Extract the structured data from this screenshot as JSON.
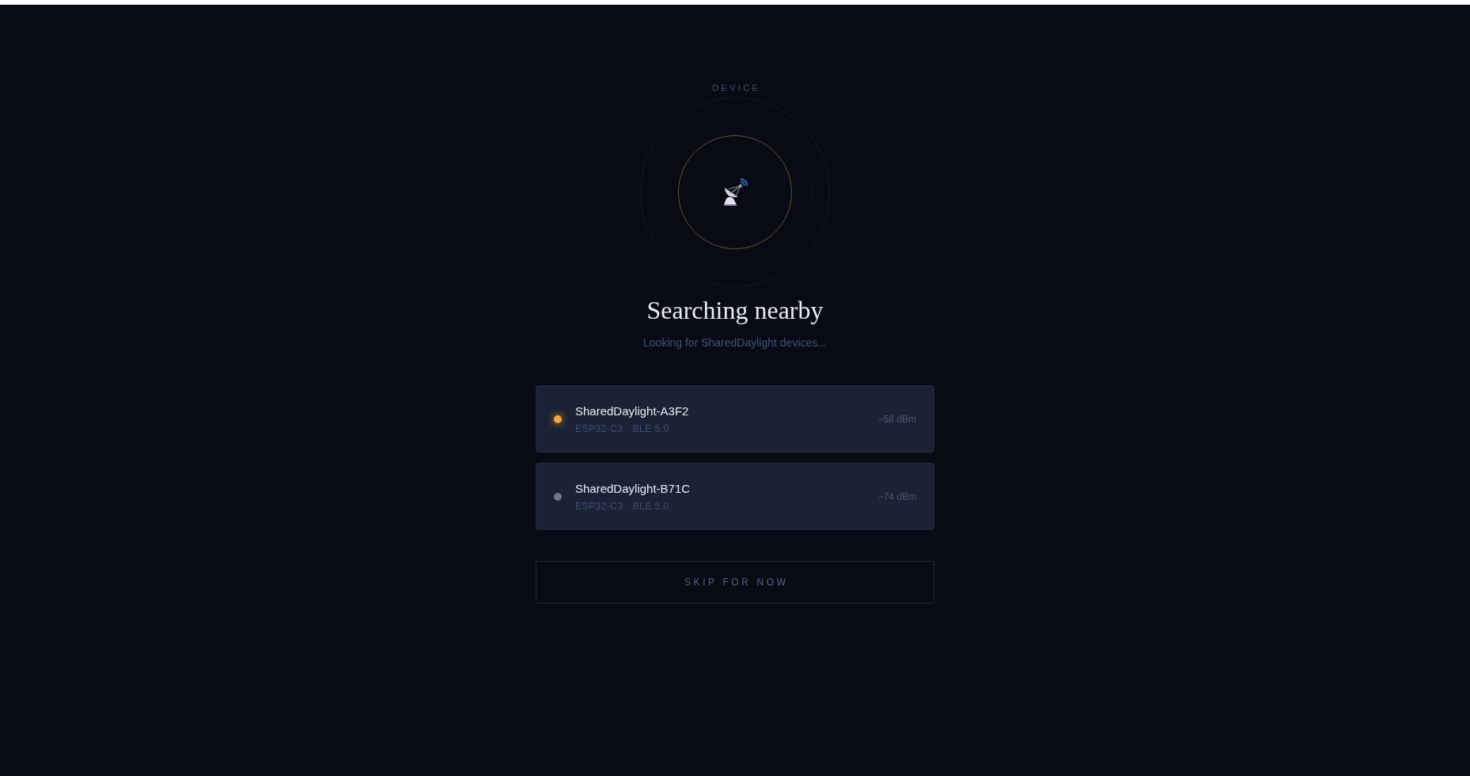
{
  "header": {
    "label": "DEVICE"
  },
  "title": "Searching nearby",
  "subtitle": "Looking for SharedDaylight devices...",
  "devices": [
    {
      "name": "SharedDaylight-A3F2",
      "details": "ESP32-C3 · BLE 5.0",
      "signal": "−58 dBm",
      "color": "#f5a93b",
      "active": true
    },
    {
      "name": "SharedDaylight-B71C",
      "details": "ESP32-C3 · BLE 5.0",
      "signal": "−74 dBm",
      "color": "#6b7590",
      "active": false
    }
  ],
  "skip_button": {
    "label": "SKIP FOR NOW"
  }
}
